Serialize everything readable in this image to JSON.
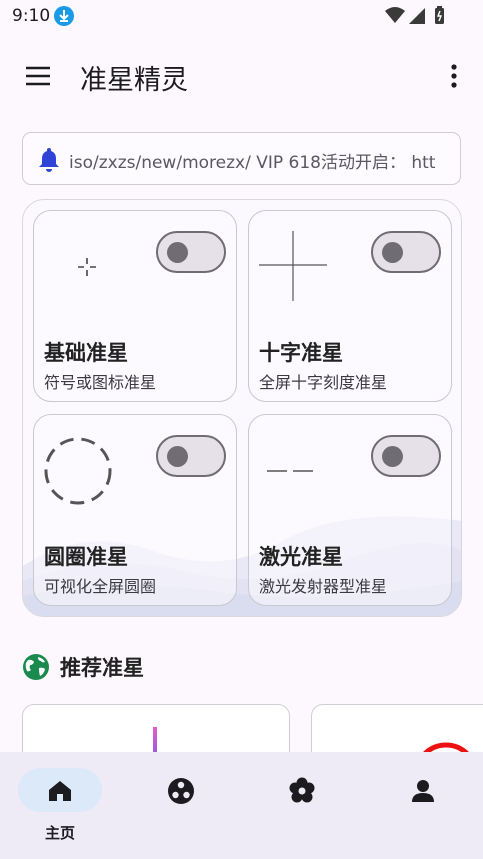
{
  "status_bar": {
    "time": "9:10"
  },
  "app_bar": {
    "title": "准星精灵"
  },
  "notice": {
    "text": "iso/zxzs/new/morezx/ VIP 618活动开启： htt"
  },
  "crosshairs": [
    {
      "title": "基础准星",
      "subtitle": "符号或图标准星",
      "enabled": false
    },
    {
      "title": "十字准星",
      "subtitle": "全屏十字刻度准星",
      "enabled": false
    },
    {
      "title": "圆圈准星",
      "subtitle": "可视化全屏圆圈",
      "enabled": false
    },
    {
      "title": "激光准星",
      "subtitle": "激光发射器型准星",
      "enabled": false
    }
  ],
  "recommended": {
    "title": "推荐准星"
  },
  "bottom_nav": {
    "items": [
      {
        "label": "主页",
        "icon": "home-icon",
        "active": true
      },
      {
        "label": "",
        "icon": "game-icon",
        "active": false
      },
      {
        "label": "",
        "icon": "flower-settings-icon",
        "active": false
      },
      {
        "label": "",
        "icon": "person-icon",
        "active": false
      }
    ]
  },
  "colors": {
    "accent": "#1a9be8",
    "bell": "#2f44d6",
    "globe": "#1a8a4e",
    "nav_background": "#eeebf7",
    "nav_active_pill": "#dbe9f8"
  }
}
